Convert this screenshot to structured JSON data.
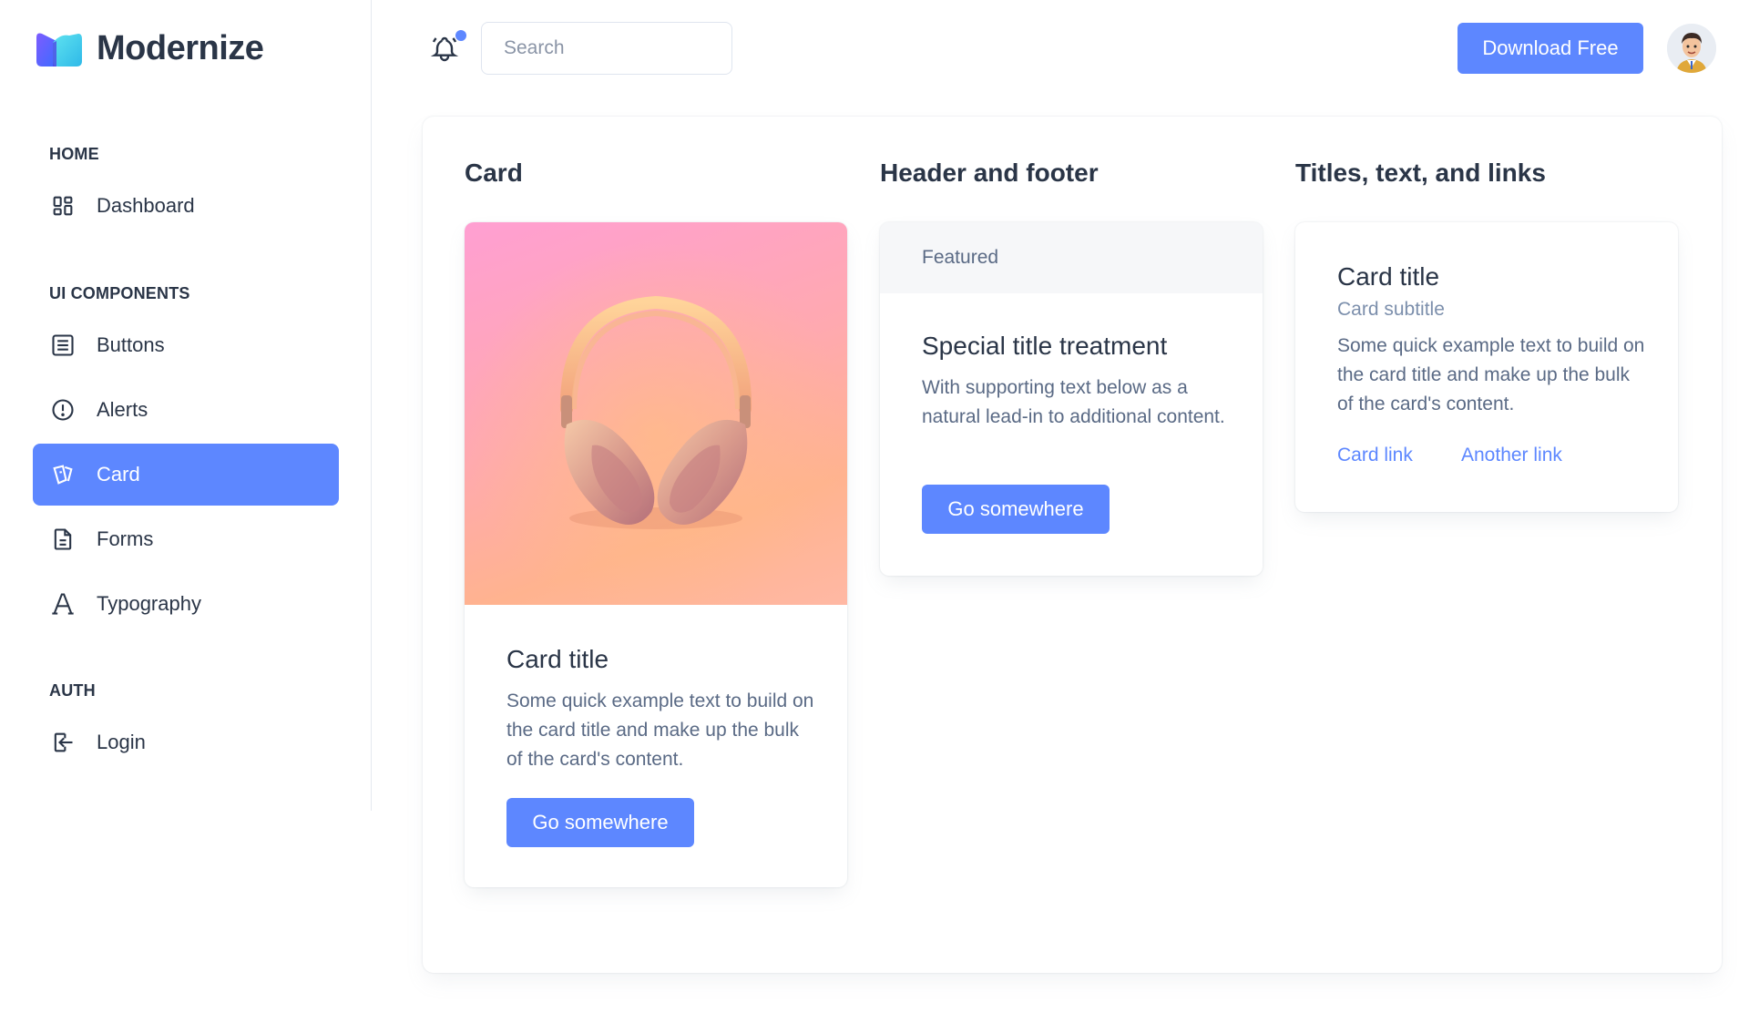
{
  "brand": {
    "name": "Modernize"
  },
  "sidebar": {
    "sections": [
      {
        "label": "HOME"
      },
      {
        "label": "UI COMPONENTS"
      },
      {
        "label": "AUTH"
      }
    ],
    "items": [
      {
        "label": "Dashboard",
        "icon": "dashboard-icon"
      },
      {
        "label": "Buttons",
        "icon": "list-icon"
      },
      {
        "label": "Alerts",
        "icon": "alert-circle-icon"
      },
      {
        "label": "Card",
        "icon": "cards-icon",
        "active": true
      },
      {
        "label": "Forms",
        "icon": "file-text-icon"
      },
      {
        "label": "Typography",
        "icon": "typography-icon"
      },
      {
        "label": "Login",
        "icon": "login-icon"
      }
    ]
  },
  "header": {
    "search_placeholder": "Search",
    "download_label": "Download Free",
    "notification_icon": "bell-icon"
  },
  "main": {
    "columns": [
      {
        "title": "Card"
      },
      {
        "title": "Header and footer"
      },
      {
        "title": "Titles, text, and links"
      }
    ],
    "image_card": {
      "title": "Card title",
      "text": "Some quick example text to build on the card title and make up the bulk of the card's content.",
      "button": "Go somewhere"
    },
    "header_card": {
      "header": "Featured",
      "title": "Special title treatment",
      "text": "With supporting text below as a natural lead-in to additional content.",
      "button": "Go somewhere"
    },
    "links_card": {
      "title": "Card title",
      "subtitle": "Card subtitle",
      "text": "Some quick example text to build on the card title and make up the bulk of the card's content.",
      "link1": "Card link",
      "link2": "Another link"
    }
  },
  "colors": {
    "primary": "#5d87ff",
    "text": "#2a3547",
    "muted": "#5a6a85"
  }
}
